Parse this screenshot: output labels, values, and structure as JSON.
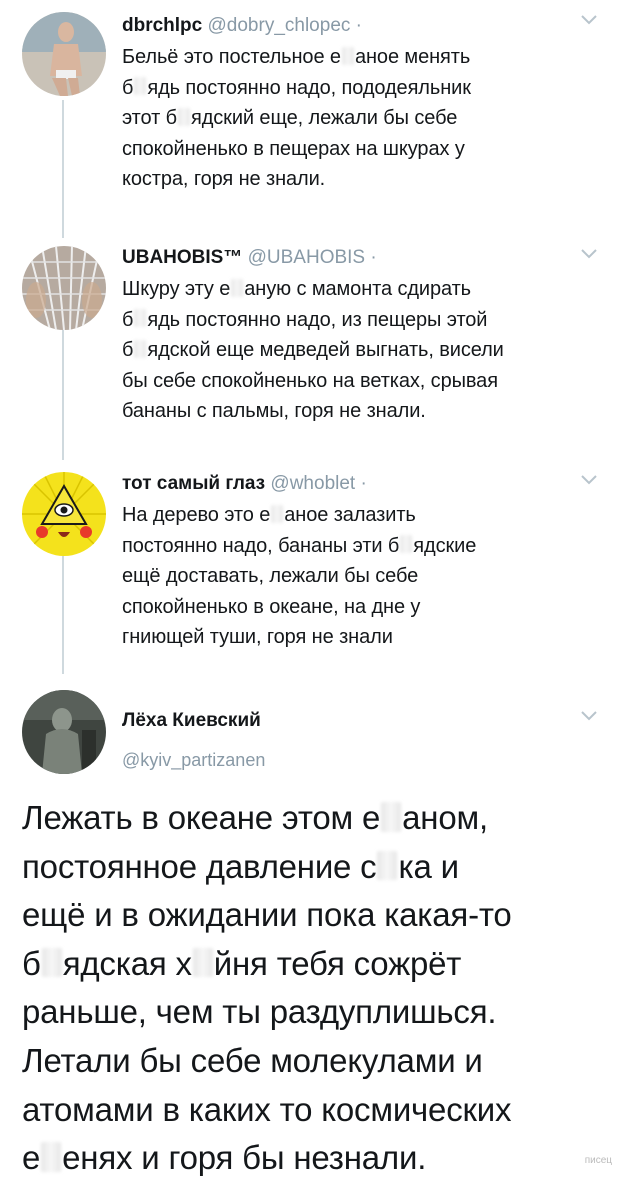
{
  "thread": [
    {
      "name": "dbrchlpc",
      "handle": "@dobry_chlopec",
      "dot": "·",
      "lines": [
        [
          "Бельё это постельное е",
          "аное менять"
        ],
        [
          "б",
          "ядь постоянно надо, пододеяльник"
        ],
        [
          "этот б",
          "ядский еще, лежали бы себе"
        ],
        [
          "спокойненько в пещерах на шкурах у"
        ],
        [
          "костра, горя не знали."
        ]
      ]
    },
    {
      "name": "UBAHOBIS™",
      "handle": "@UBAHOBIS",
      "dot": "·",
      "lines": [
        [
          "Шкуру эту е",
          "аную с мамонта сдирать"
        ],
        [
          "б",
          "ядь постоянно надо, из пещеры этой"
        ],
        [
          "б",
          "ядской еще медведей выгнать, висели"
        ],
        [
          "бы себе спокойненько на ветках, срывая"
        ],
        [
          "бананы с пальмы, горя не знали."
        ]
      ]
    },
    {
      "name": "тот самый глаз",
      "handle": "@whoblet",
      "dot": "·",
      "lines": [
        [
          "На дерево это е",
          "аное залазить"
        ],
        [
          "постоянно надо, бананы эти б",
          "ядские"
        ],
        [
          "ещё доставать, лежали бы себе"
        ],
        [
          "спокойненько в океане, на дне у"
        ],
        [
          "гниющей туши, горя не знали"
        ]
      ]
    }
  ],
  "main": {
    "name": "Лёха Киевский",
    "handle": "@kyiv_partizanen",
    "lines": [
      [
        "Лежать в океане этом е",
        "аном,"
      ],
      [
        "постоянное давление с",
        "ка и"
      ],
      [
        "ещё и в ожидании пока какая-то"
      ],
      [
        "б",
        "ядская х",
        "йня тебя сожрёт"
      ],
      [
        "раньше, чем ты раздуплишься."
      ],
      [
        "Летали бы себе молекулами и"
      ],
      [
        "атомами в каких то космических"
      ],
      [
        "е",
        "енях и горя бы незнали."
      ]
    ]
  },
  "watermark": "писец",
  "icons": {
    "chevron": "chevron-down-icon",
    "avatar1": "avatar-photo-man",
    "avatar2": "avatar-net-pattern",
    "avatar3": "avatar-yellow-eye",
    "avatar4": "avatar-dark-figure"
  },
  "colors": {
    "text": "#14171a",
    "secondary": "#8899a6",
    "thread_line": "#cfd9de"
  }
}
